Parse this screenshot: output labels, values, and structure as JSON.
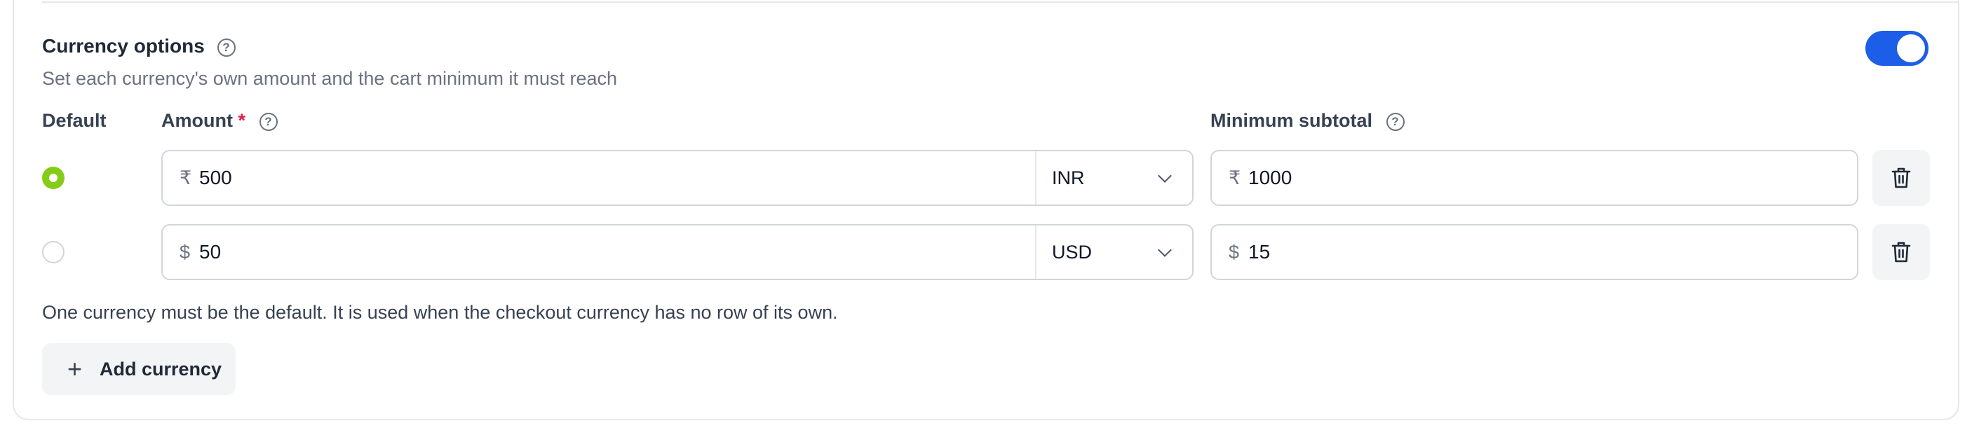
{
  "section": {
    "title": "Currency options",
    "subtitle": "Set each currency's own amount and the cart minimum it must reach",
    "enabled": true
  },
  "columns": {
    "default": "Default",
    "amount": "Amount",
    "required_mark": "*",
    "min_subtotal": "Minimum subtotal"
  },
  "rows": [
    {
      "is_default": true,
      "amount_symbol": "₹",
      "amount": "500",
      "currency": "INR",
      "min_symbol": "₹",
      "min_subtotal": "1000"
    },
    {
      "is_default": false,
      "amount_symbol": "$",
      "amount": "50",
      "currency": "USD",
      "min_symbol": "$",
      "min_subtotal": "15"
    }
  ],
  "note": "One currency must be the default. It is used when the checkout currency has no row of its own.",
  "add_button": {
    "label": "Add currency"
  },
  "help_glyph": "?",
  "colors": {
    "toggle": "#1d5ee8",
    "radio_selected": "#84cc16",
    "required": "#e11d48"
  }
}
